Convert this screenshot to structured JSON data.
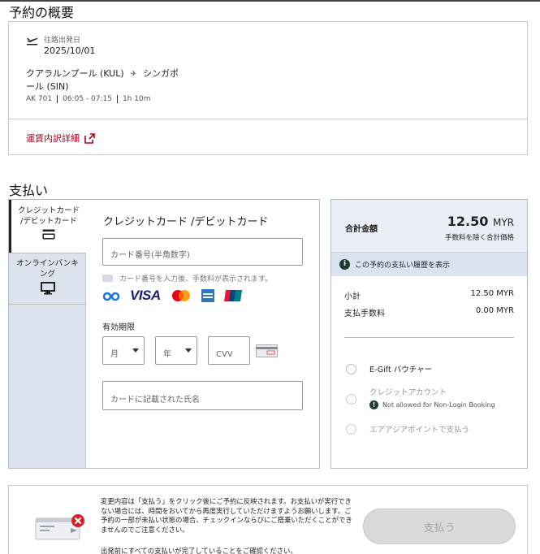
{
  "summary": {
    "heading": "予約の概要",
    "flight_label": "往路出発日",
    "date": "2025/10/01",
    "route_from": "クアラルンプール (KUL)",
    "route_to": "シンガポール (SIN)",
    "flight_no": "AK 701",
    "time": "06:05 - 07:15",
    "duration": "1h 10m",
    "fare_link": "運賃内訳詳細"
  },
  "payment": {
    "heading": "支払い",
    "tabs": [
      {
        "label": "クレジットカード /デビットカード",
        "icon": "credit-card-icon"
      },
      {
        "label": "オンラインバンキング",
        "icon": "monitor-icon"
      }
    ],
    "card_title": "クレジットカード /デビットカード",
    "card_number_placeholder": "カード番号(半角数字)",
    "card_hint": "カード番号を入力後、手数料が表示されます。",
    "brands": [
      "bp",
      "VISA",
      "mastercard",
      "amex",
      "unionpay"
    ],
    "expiry_label": "有効期限",
    "month_placeholder": "月",
    "year_placeholder": "年",
    "cvv_placeholder": "CVV",
    "name_placeholder": "カードに記載された氏名"
  },
  "total": {
    "label": "合計金額",
    "amount": "12.50",
    "currency": "MYR",
    "note": "手数料を除く合計価格",
    "history_link": "この予約の支払い履歴を表示",
    "subtotal_label": "小計",
    "subtotal_value": "12.50 MYR",
    "fee_label": "支払手数料",
    "fee_value": "0.00 MYR",
    "options": [
      {
        "label": "E-Gift バウチャー",
        "note": "",
        "disabled": false
      },
      {
        "label": "クレジットアカウント",
        "note": "Not allowed for Non-Login Booking",
        "disabled": true
      },
      {
        "label": "エアアジアポイントで支払う",
        "note": "",
        "disabled": true
      }
    ]
  },
  "footer": {
    "notice": "変更内容は「支払う」をクリック後にご予約に反映されます。お支払いが実行できない場合には、時間をおいてから再度実行していただけますようお願いします。ご予約の一部が未払い状態の場合、チェックインならびにご搭乗いただくことができませんのでご注意ください。",
    "notice2": "出発前にすべての支払いが完了していることをご確認ください。",
    "pay_button": "支払う"
  },
  "colors": {
    "accent": "#b0001e",
    "blue_bg": "#e9eef7",
    "tab_bg": "#dde3ee",
    "button_disabled": "#d9d9d9"
  }
}
